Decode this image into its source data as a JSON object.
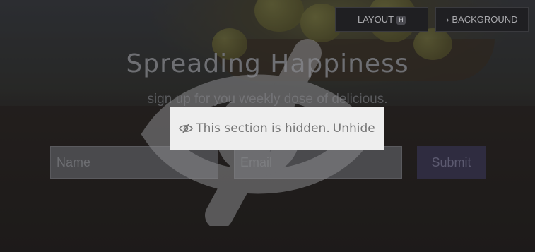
{
  "toolbar": {
    "layout_label": "LAYOUT",
    "layout_shortcut": "H",
    "background_label": "BACKGROUND"
  },
  "section": {
    "heading": "Spreading Happiness",
    "subheading": "sign up for you weekly dose of delicious.",
    "name_placeholder": "Name",
    "email_placeholder": "Email",
    "submit_label": "Submit"
  },
  "hidden_notice": {
    "message": "This section is hidden.",
    "unhide_label": "Unhide"
  },
  "icons": {
    "hidden": "eye-slash-icon",
    "chevron": "chevron-right-icon"
  }
}
